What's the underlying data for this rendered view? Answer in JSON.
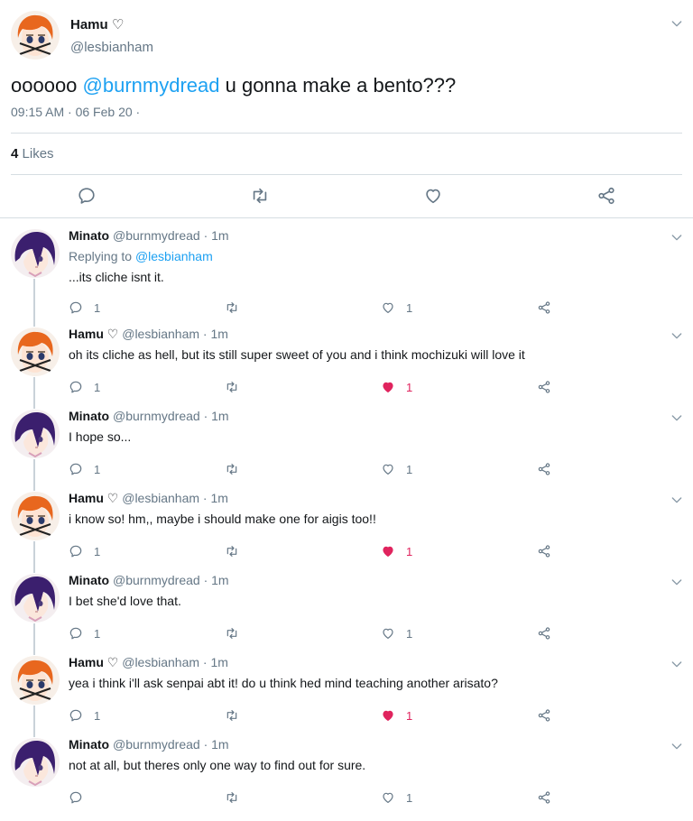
{
  "colors": {
    "accent": "#1da1f2",
    "muted": "#657786",
    "like": "#e0245e",
    "text": "#14171a"
  },
  "main_tweet": {
    "name": "Hamu ♡",
    "handle": "@lesbianham",
    "text_prefix": "oooooo ",
    "mention": "@burnmydread",
    "text_suffix": " u gonna make a bento???",
    "timestamp": "09:15 AM · 06 Feb 20 ·",
    "likes_count": "4",
    "likes_label": "Likes"
  },
  "replies": [
    {
      "name": "Minato",
      "meta": "@burnmydread · 1m",
      "replying_label": "Replying to",
      "replying_to": "@lesbianham",
      "text": "...its cliche isnt it.",
      "reply_count": "1",
      "like_count": "1",
      "liked": false,
      "avatar": "minato"
    },
    {
      "name": "Hamu ♡",
      "meta": "@lesbianham · 1m",
      "text": "oh its cliche as hell, but its still super sweet of you and i think mochizuki will love it",
      "reply_count": "1",
      "like_count": "1",
      "liked": true,
      "avatar": "hamu"
    },
    {
      "name": "Minato",
      "meta": "@burnmydread · 1m",
      "text": "I hope so...",
      "reply_count": "1",
      "like_count": "1",
      "liked": false,
      "avatar": "minato"
    },
    {
      "name": "Hamu ♡",
      "meta": "@lesbianham · 1m",
      "text": "i know so! hm,, maybe i should make one for aigis too!!",
      "reply_count": "1",
      "like_count": "1",
      "liked": true,
      "avatar": "hamu"
    },
    {
      "name": "Minato",
      "meta": "@burnmydread · 1m",
      "text": "I bet she'd love that.",
      "reply_count": "1",
      "like_count": "1",
      "liked": false,
      "avatar": "minato"
    },
    {
      "name": "Hamu ♡",
      "meta": "@lesbianham · 1m",
      "text": "yea i think i'll ask senpai abt it! do u think hed mind teaching another arisato?",
      "reply_count": "1",
      "like_count": "1",
      "liked": true,
      "avatar": "hamu"
    },
    {
      "name": "Minato",
      "meta": "@burnmydread · 1m",
      "text": "not at all, but theres only one way to find out for sure.",
      "reply_count": "",
      "like_count": "1",
      "liked": false,
      "avatar": "minato"
    }
  ]
}
